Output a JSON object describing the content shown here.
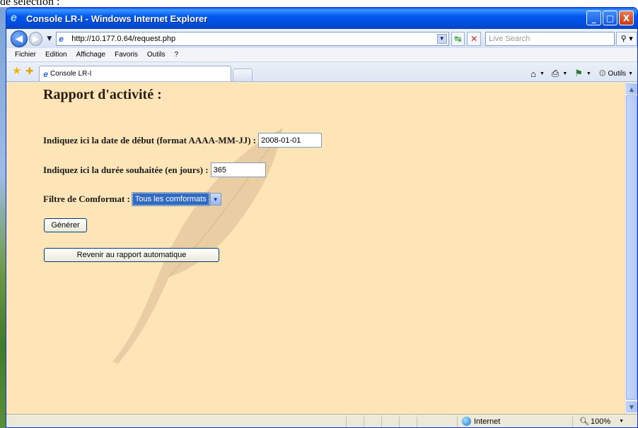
{
  "doc_top_text": "de sélection :",
  "window": {
    "title": "Console LR-I - Windows Internet Explorer",
    "minimize": "_",
    "maximize": "□",
    "close": "X"
  },
  "address": {
    "url": "http://10.177.0.64/request.php",
    "search_placeholder": "Live Search"
  },
  "menu": [
    "Fichier",
    "Edition",
    "Affichage",
    "Favoris",
    "Outils",
    "?"
  ],
  "tab": {
    "label": "Console LR-I"
  },
  "commands": {
    "tools_label": "Outils"
  },
  "page": {
    "title": "Rapport d'activité :",
    "start_label": "Indiquez ici la date de début (format AAAA-MM-JJ) :",
    "start_value": "2008-01-01",
    "duration_label": "Indiquez ici la durée souhaitée (en jours) :",
    "duration_value": "365",
    "filter_label": "Filtre de Comformat :",
    "filter_value": "Tous les comformats",
    "generate_button": "Générer",
    "back_button": "Revenir au rapport automatique"
  },
  "status": {
    "zone": "Internet",
    "zoom": "100%"
  },
  "colors": {
    "page_background": "#fde5b8",
    "titlebar": "#0058ee",
    "selection": "#316ac5"
  }
}
